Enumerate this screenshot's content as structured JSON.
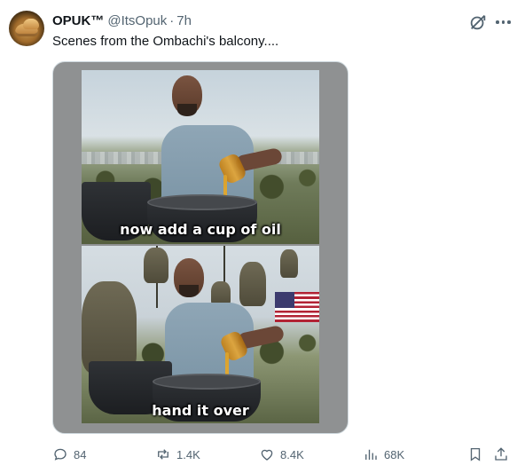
{
  "tweet": {
    "author_name": "OPUK™",
    "handle": "@ItsOpuk",
    "separator": "·",
    "time": "7h",
    "text": "Scenes from the Ombachi's balcony...."
  },
  "media": {
    "caption_top": "now add a cup of oil",
    "caption_bottom": "hand it over"
  },
  "actions": {
    "replies": "84",
    "reposts": "1.4K",
    "likes": "8.4K",
    "views": "68K"
  },
  "icons": {
    "reply": "reply-icon",
    "repost": "repost-icon",
    "like": "heart-icon",
    "views": "views-icon",
    "bookmark": "bookmark-icon",
    "share": "share-icon",
    "grok": "grok-icon",
    "more": "more-icon"
  },
  "colors": {
    "text_primary": "#0f1419",
    "text_secondary": "#536471",
    "border": "#cfd9de"
  }
}
